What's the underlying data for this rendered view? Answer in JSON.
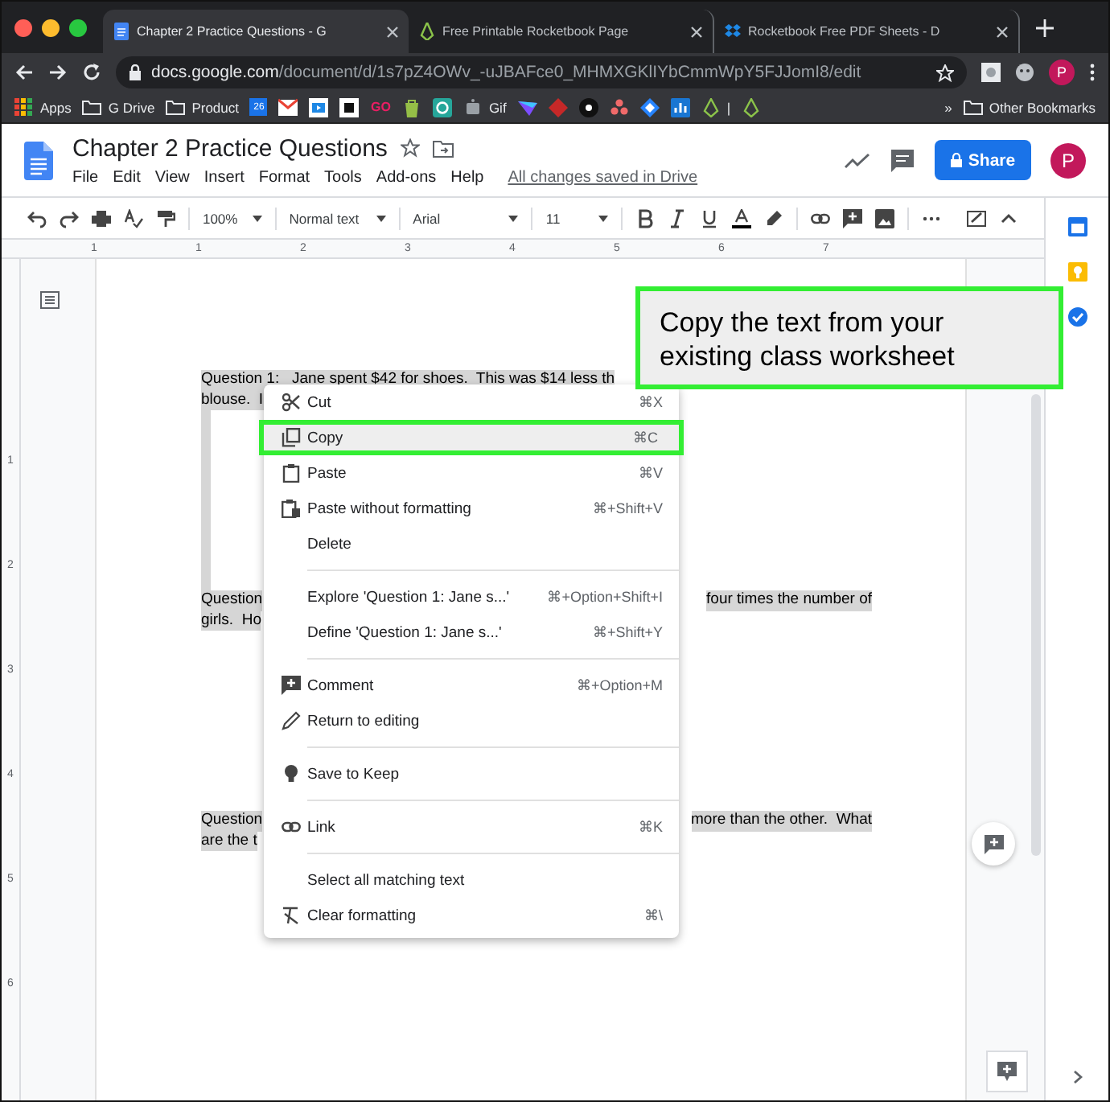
{
  "browser": {
    "tabs": [
      {
        "title": "Chapter 2 Practice Questions - G",
        "selected": true
      },
      {
        "title": "Free Printable Rocketbook Page",
        "selected": false
      },
      {
        "title": "Rocketbook Free PDF Sheets - D",
        "selected": false
      }
    ],
    "address": {
      "domain": "docs.google.com",
      "path": "/document/d/1s7pZ4OWv_-uJBAFce0_MHMXGKlIYbCmmWpY5FJJomI8/edit"
    },
    "avatar": "P",
    "bookmarks": [
      {
        "kind": "labeled",
        "label": "Apps"
      },
      {
        "kind": "labeled",
        "label": "G Drive"
      },
      {
        "kind": "labeled",
        "label": "Product"
      },
      {
        "kind": "logo",
        "label": "26"
      },
      {
        "kind": "icon"
      },
      {
        "kind": "icon"
      },
      {
        "kind": "icon"
      },
      {
        "kind": "logo",
        "label": "GO"
      },
      {
        "kind": "icon"
      },
      {
        "kind": "icon"
      },
      {
        "kind": "labeled",
        "label": "Gif"
      },
      {
        "kind": "icon"
      },
      {
        "kind": "icon"
      },
      {
        "kind": "icon"
      },
      {
        "kind": "icon"
      },
      {
        "kind": "icon"
      },
      {
        "kind": "icon"
      },
      {
        "kind": "labeled",
        "label": "|"
      },
      {
        "kind": "icon"
      }
    ],
    "overflow": "»",
    "other_bookmarks": "Other Bookmarks"
  },
  "doc": {
    "title": "Chapter 2 Practice Questions",
    "menus": [
      "File",
      "Edit",
      "View",
      "Insert",
      "Format",
      "Tools",
      "Add-ons",
      "Help"
    ],
    "save_status": "All changes saved in Drive",
    "share": "Share",
    "avatar": "P"
  },
  "toolbar": {
    "zoom": "100%",
    "style": "Normal text",
    "font": "Arial",
    "size": "11"
  },
  "ruler": [
    "1",
    "1",
    "2",
    "3",
    "4",
    "5",
    "6",
    "7"
  ],
  "vertical_ruler": [
    "1",
    "2",
    "3",
    "4",
    "5",
    "6"
  ],
  "paragraphs": [
    {
      "kind": "text",
      "selected": true,
      "lines": [
        {
          "left": "Question 1:   Jane spent $42 for shoes.  This was $14 less th"
        },
        {
          "left": "blouse.  I"
        }
      ]
    },
    {
      "kind": "blank",
      "selected": true
    },
    {
      "kind": "text",
      "selected": true,
      "lines": [
        {
          "left": "Question",
          "right": "four times the number of"
        },
        {
          "left": "girls.  Ho"
        }
      ]
    },
    {
      "kind": "text",
      "selected": true,
      "lines": [
        {
          "left": "Question",
          "right": "more than the other.  What"
        },
        {
          "left": "are the t"
        }
      ]
    }
  ],
  "context_menu": [
    {
      "kind": "item",
      "label": "Cut",
      "shortcut": "⌘X",
      "selected": false,
      "annotated": false
    },
    {
      "kind": "item",
      "label": "Copy",
      "shortcut": "⌘C",
      "selected": true,
      "annotated": true
    },
    {
      "kind": "item",
      "label": "Paste",
      "shortcut": "⌘V",
      "selected": false,
      "annotated": false
    },
    {
      "kind": "item",
      "label": "Paste without formatting",
      "shortcut": "⌘+Shift+V",
      "selected": false,
      "annotated": false
    },
    {
      "kind": "item",
      "label": "Delete",
      "selected": false,
      "annotated": false
    },
    {
      "kind": "separator"
    },
    {
      "kind": "item",
      "label": "Explore 'Question 1: Jane s...'",
      "shortcut": "⌘+Option+Shift+I",
      "selected": false,
      "annotated": false
    },
    {
      "kind": "item",
      "label": "Define 'Question 1: Jane s...'",
      "shortcut": "⌘+Shift+Y",
      "selected": false,
      "annotated": false
    },
    {
      "kind": "separator"
    },
    {
      "kind": "item",
      "label": "Comment",
      "shortcut": "⌘+Option+M",
      "selected": false,
      "annotated": false
    },
    {
      "kind": "item",
      "label": "Return to editing",
      "selected": false,
      "annotated": false
    },
    {
      "kind": "separator"
    },
    {
      "kind": "item",
      "label": "Save to Keep",
      "selected": false,
      "annotated": false
    },
    {
      "kind": "separator"
    },
    {
      "kind": "item",
      "label": "Link",
      "shortcut": "⌘K",
      "selected": false,
      "annotated": false
    },
    {
      "kind": "separator"
    },
    {
      "kind": "item",
      "label": "Select all matching text",
      "selected": false,
      "annotated": false
    },
    {
      "kind": "item",
      "label": "Clear formatting",
      "shortcut": "⌘\\",
      "selected": false,
      "annotated": false
    }
  ],
  "callout": {
    "text": "Copy the text from your existing class worksheet"
  }
}
